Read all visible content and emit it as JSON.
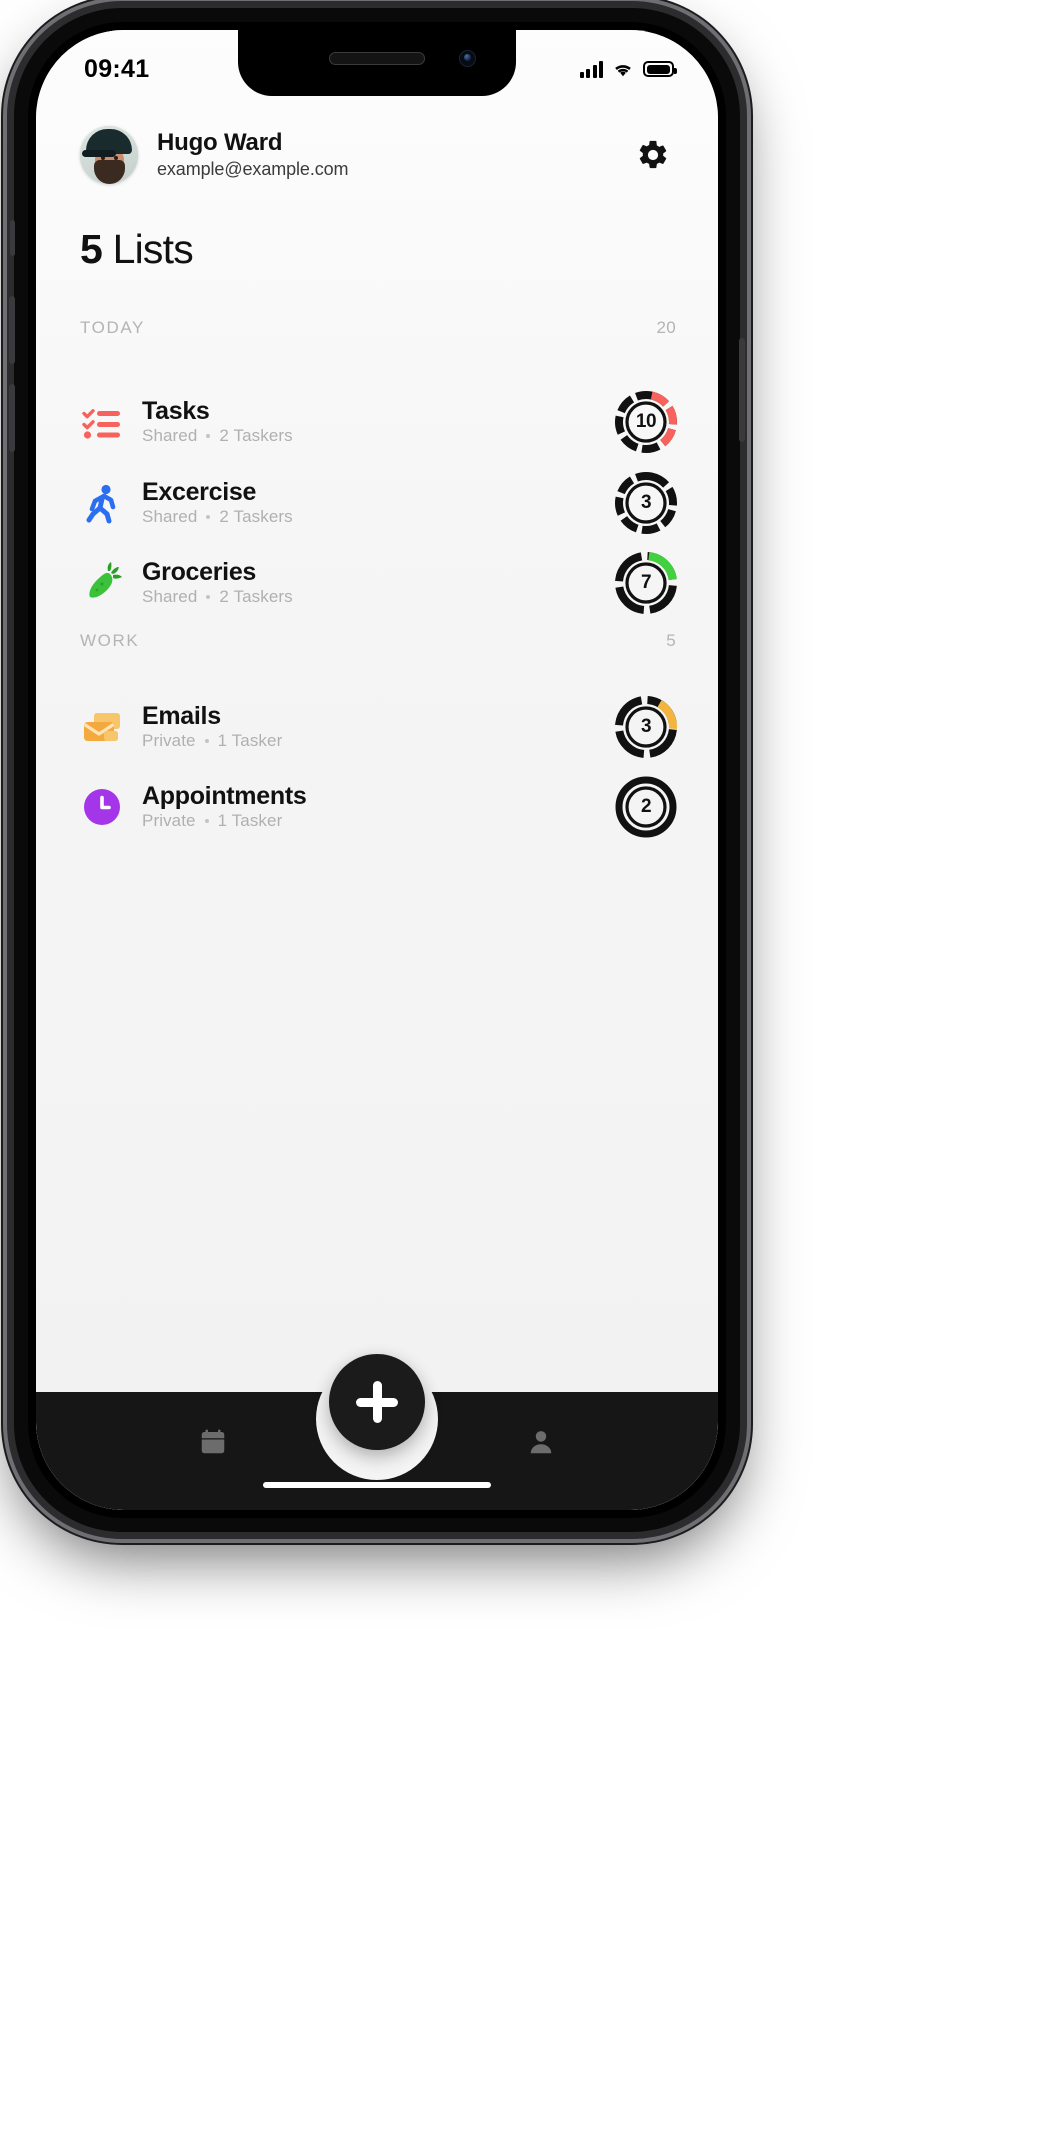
{
  "status_bar": {
    "time": "09:41",
    "signal_icon": "cellular-signal-icon",
    "wifi_icon": "wifi-icon",
    "battery_icon": "battery-full-icon"
  },
  "profile": {
    "name": "Hugo Ward",
    "email": "example@example.com",
    "avatar_icon": "user-avatar",
    "settings_icon": "gear-icon"
  },
  "page_title": {
    "count": "5",
    "word": "Lists"
  },
  "sections": [
    {
      "title": "TODAY",
      "count": "20",
      "items": [
        {
          "name": "Tasks",
          "privacy": "Shared",
          "taskers": "2 Taskers",
          "badge_value": "10",
          "icon": "checklist-icon",
          "icon_color": "#F8625C",
          "ring_style": "segmented",
          "ring_color": "#F8625C",
          "ring_base_color": "#111111"
        },
        {
          "name": "Excercise",
          "privacy": "Shared",
          "taskers": "2 Taskers",
          "badge_value": "3",
          "icon": "running-person-icon",
          "icon_color": "#2B6FF0",
          "ring_style": "segmented",
          "ring_color": "#111111",
          "ring_base_color": "#111111"
        },
        {
          "name": "Groceries",
          "privacy": "Shared",
          "taskers": "2 Taskers",
          "badge_value": "7",
          "icon": "carrot-icon",
          "icon_color": "#3CC13B",
          "ring_style": "arc",
          "ring_color": "#41D13F",
          "ring_base_color": "#111111"
        }
      ]
    },
    {
      "title": "WORK",
      "count": "5",
      "items": [
        {
          "name": "Emails",
          "privacy": "Private",
          "taskers": "1 Tasker",
          "badge_value": "3",
          "icon": "envelope-icon",
          "icon_color": "#F4B53F",
          "ring_style": "arc",
          "ring_color": "#F4B53F",
          "ring_base_color": "#111111"
        },
        {
          "name": "Appointments",
          "privacy": "Private",
          "taskers": "1 Tasker",
          "badge_value": "2",
          "icon": "clock-icon",
          "icon_color": "#A435E8",
          "ring_style": "plain",
          "ring_color": "#111111",
          "ring_base_color": "#111111"
        }
      ]
    }
  ],
  "bottom_nav": {
    "calendar_icon": "calendar-icon",
    "profile_icon": "person-icon",
    "add_icon": "plus-icon"
  },
  "colors": {
    "background": "#f4f4f4",
    "nav_background": "#161616",
    "text_primary": "#111111",
    "text_muted": "#b0b0b0"
  }
}
